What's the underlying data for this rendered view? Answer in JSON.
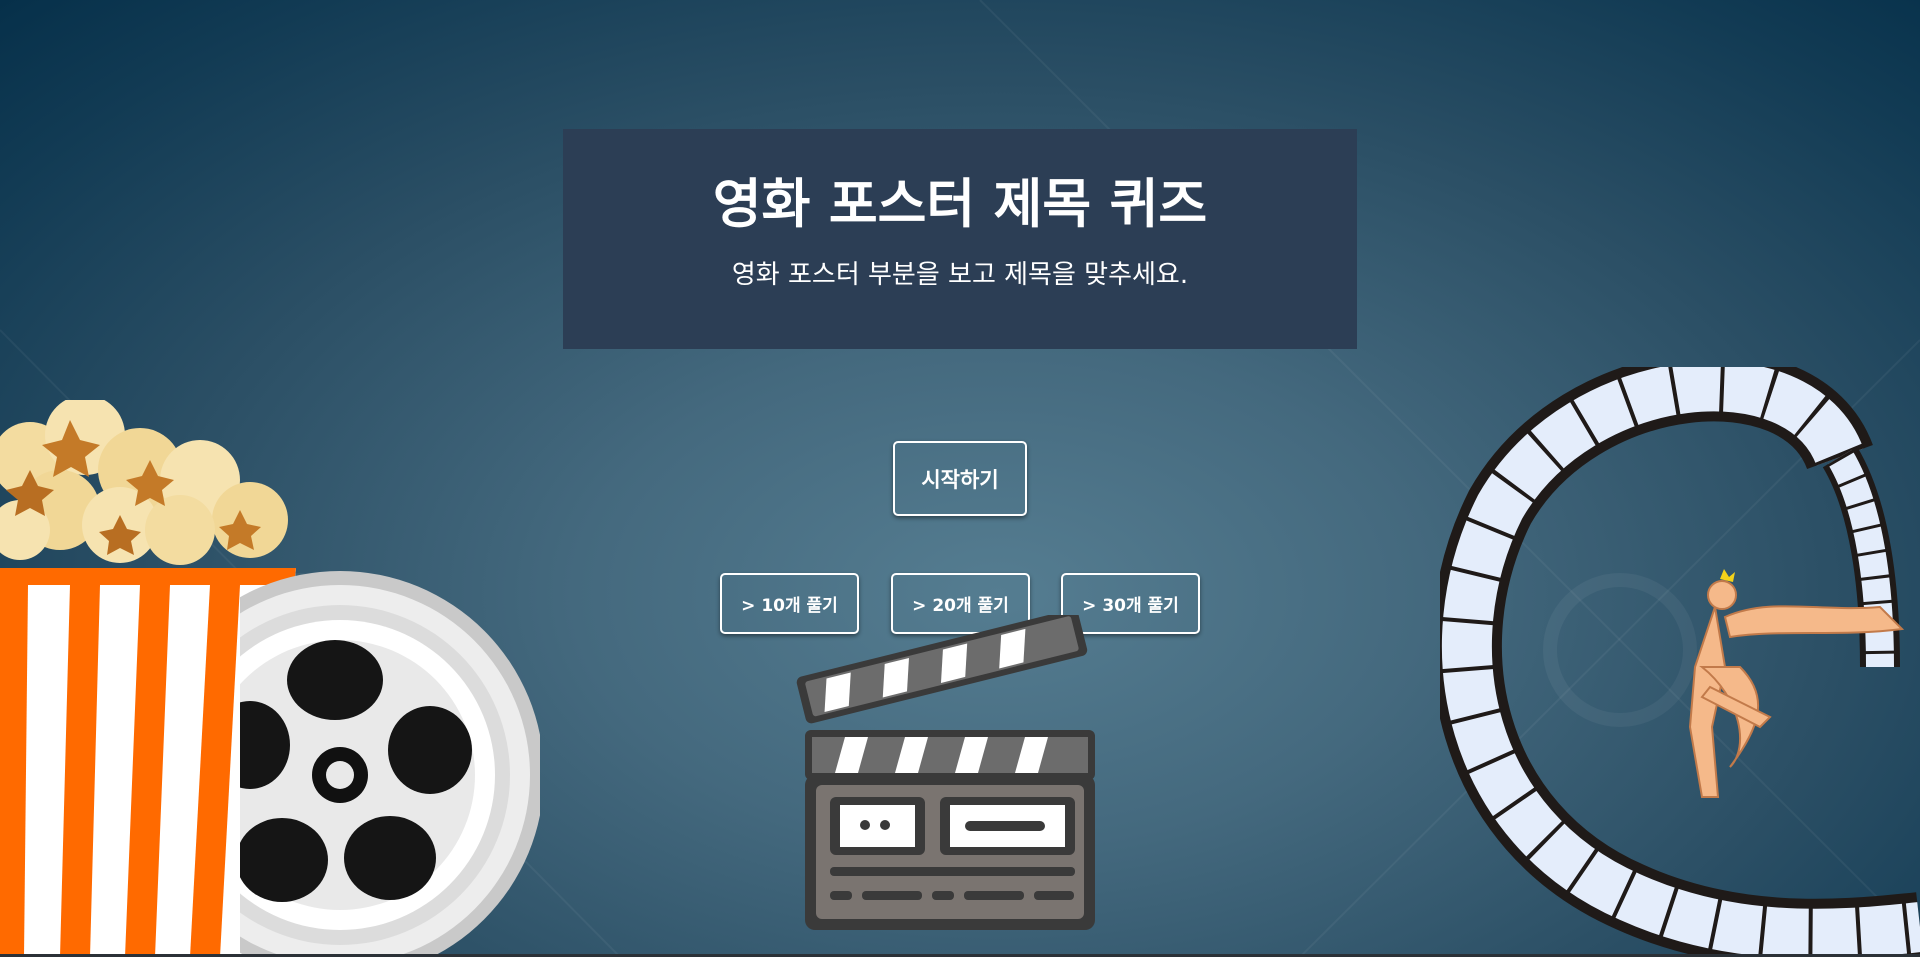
{
  "header": {
    "title": "영화 포스터 제목 퀴즈",
    "subtitle": "영화 포스터 부분을 보고 제목을 맞추세요."
  },
  "actions": {
    "start_label": "시작하기",
    "options": [
      {
        "label": "> 10개 풀기"
      },
      {
        "label": "> 20개 풀기"
      },
      {
        "label": "> 30개 풀기"
      }
    ]
  },
  "decorations": {
    "left": [
      "popcorn-icon",
      "film-reel-icon"
    ],
    "center": "clapperboard-icon",
    "right": "film-strip-icon",
    "accent_orange": "#ff6a00",
    "card_color": "#2c3e55"
  }
}
